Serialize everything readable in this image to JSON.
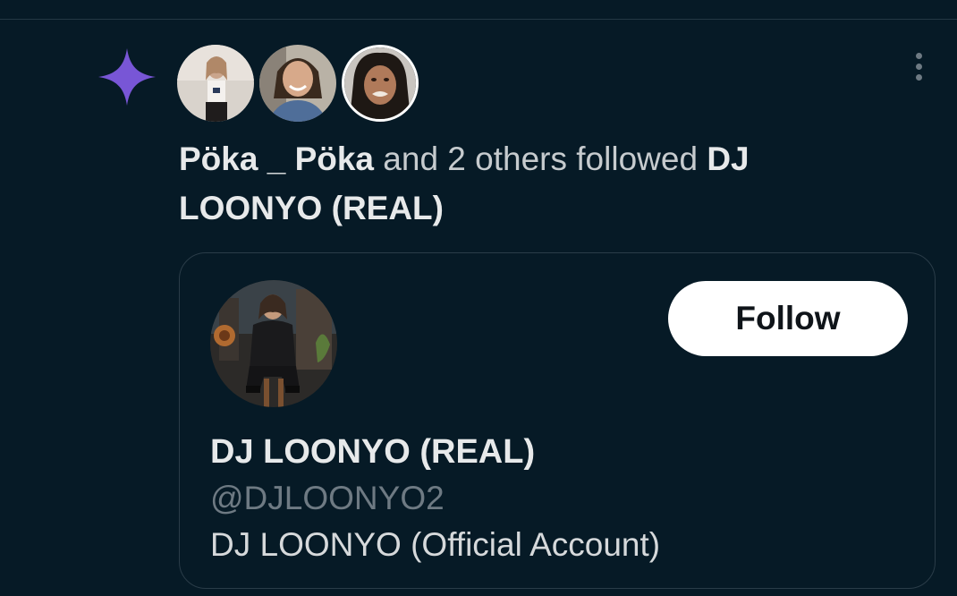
{
  "activity": {
    "actor_name": "Pöka _ Pöka",
    "connector": " and 2 others followed ",
    "target_name": "DJ LOONYO (REAL)",
    "accent_color": "#7856d6"
  },
  "avatars": [
    {
      "name": "follower-avatar-1"
    },
    {
      "name": "follower-avatar-2"
    },
    {
      "name": "follower-avatar-3"
    }
  ],
  "user_card": {
    "display_name": "DJ LOONYO (REAL)",
    "handle": "@DJLOONYO2",
    "bio": "DJ LOONYO (Official Account)",
    "follow_label": "Follow"
  },
  "icons": {
    "sparkle": "sparkle-icon",
    "more": "more-vertical-icon"
  }
}
